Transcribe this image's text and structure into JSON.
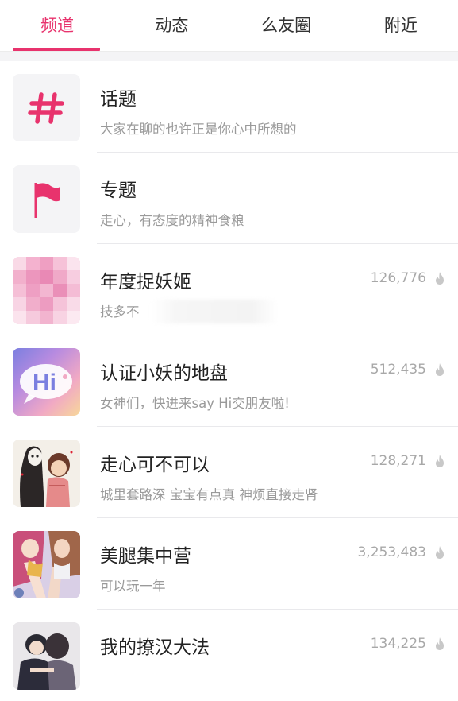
{
  "tabs": [
    {
      "label": "频道",
      "active": true
    },
    {
      "label": "动态",
      "active": false
    },
    {
      "label": "么友圈",
      "active": false
    },
    {
      "label": "附近",
      "active": false
    }
  ],
  "accent_color": "#e8336d",
  "channels": [
    {
      "title": "话题",
      "subtitle": "大家在聊的也许正是你心中所想的",
      "count": "",
      "icon": "hashtag-icon"
    },
    {
      "title": "专题",
      "subtitle": "走心，有态度的精神食粮",
      "count": "",
      "icon": "flag-icon"
    },
    {
      "title": "年度捉妖姬",
      "subtitle": "技多不",
      "count": "126,776",
      "icon": "pixelated-thumbnail"
    },
    {
      "title": "认证小妖的地盘",
      "subtitle": "女神们，快进来say Hi交朋友啦!",
      "count": "512,435",
      "icon": "hi-bubble-thumbnail"
    },
    {
      "title": "走心可不可以",
      "subtitle": "城里套路深 宝宝有点真 神烦直接走肾",
      "count": "128,271",
      "icon": "anime-couple-thumbnail"
    },
    {
      "title": "美腿集中营",
      "subtitle": "可以玩一年",
      "count": "3,253,483",
      "icon": "anime-girls-thumbnail"
    },
    {
      "title": "我的撩汉大法",
      "subtitle": "",
      "count": "134,225",
      "icon": "anime-hug-thumbnail"
    }
  ]
}
